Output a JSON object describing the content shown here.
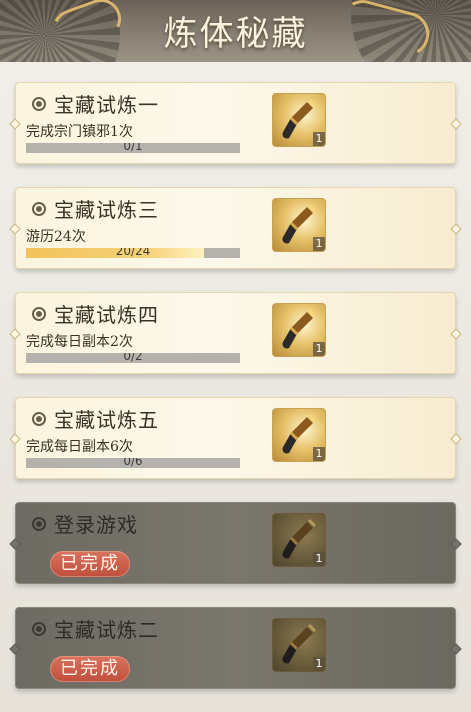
{
  "header": {
    "title": "炼体秘藏"
  },
  "tasks": [
    {
      "title": "宝藏试炼一",
      "desc": "完成宗门镇邪1次",
      "progress_text": "0/1",
      "progress": 0.0,
      "reward_count": "1",
      "status": "active"
    },
    {
      "title": "宝藏试炼三",
      "desc": "游历24次",
      "progress_text": "20/24",
      "progress": 0.83,
      "reward_count": "1",
      "status": "active"
    },
    {
      "title": "宝藏试炼四",
      "desc": "完成每日副本2次",
      "progress_text": "0/2",
      "progress": 0.0,
      "reward_count": "1",
      "status": "active"
    },
    {
      "title": "宝藏试炼五",
      "desc": "完成每日副本6次",
      "progress_text": "0/6",
      "progress": 0.0,
      "reward_count": "1",
      "status": "active"
    },
    {
      "title": "登录游戏",
      "badge": "已完成",
      "reward_count": "1",
      "status": "done"
    },
    {
      "title": "宝藏试炼二",
      "badge": "已完成",
      "reward_count": "1",
      "status": "done"
    }
  ],
  "icons": {
    "bullet": "circle-dot-icon",
    "reward": "golden-shovel-icon"
  },
  "colors": {
    "progress_fill": "#f2c35a",
    "done_badge": "#c9584a",
    "header_title": "#fbf3df"
  }
}
